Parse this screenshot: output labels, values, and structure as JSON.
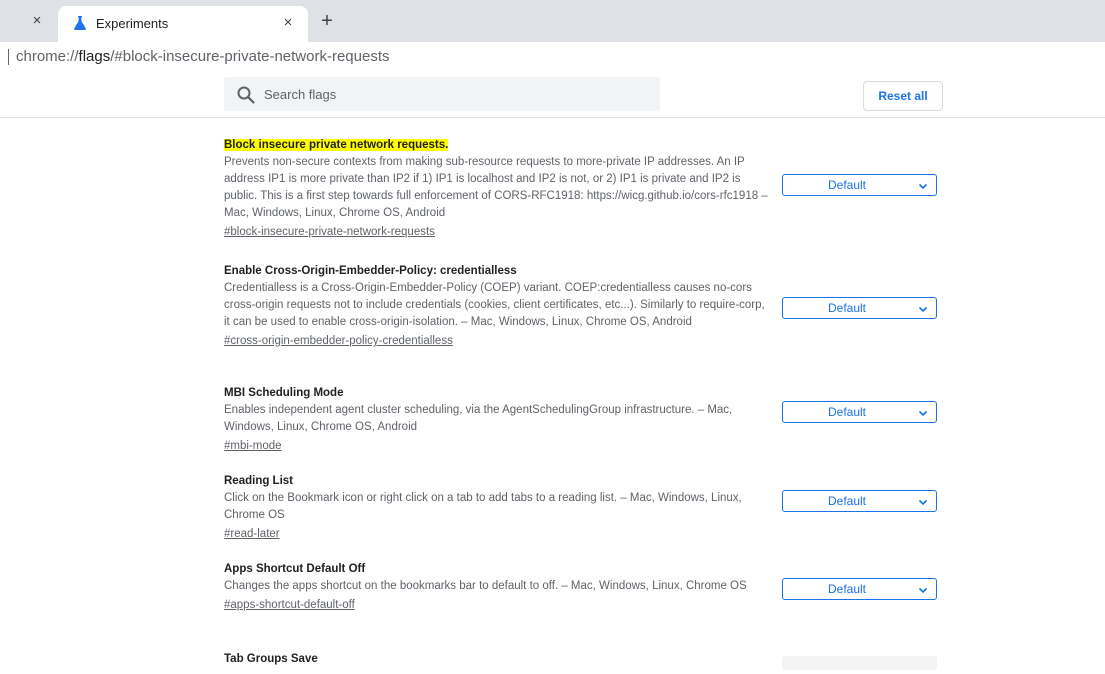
{
  "browser": {
    "tabs": [
      {
        "title": "Experiments",
        "active": true
      }
    ],
    "close_symbol": "×",
    "new_tab_symbol": "+",
    "omnibox": {
      "scheme": "chrome://",
      "host": "flags",
      "fragment": "/#block-insecure-private-network-requests"
    }
  },
  "header": {
    "search_placeholder": "Search flags",
    "reset_label": "Reset all"
  },
  "experiments": [
    {
      "title": "Block insecure private network requests.",
      "highlighted": true,
      "description": "Prevents non-secure contexts from making sub-resource requests to more-private IP addresses. An IP address IP1 is more private than IP2 if 1) IP1 is localhost and IP2 is not, or 2) IP1 is private and IP2 is public. This is a first step towards full enforcement of CORS-RFC1918: https://wicg.github.io/cors-rfc1918 – Mac, Windows, Linux, Chrome OS, Android",
      "link": "#block-insecure-private-network-requests",
      "value": "Default"
    },
    {
      "title": "Enable Cross-Origin-Embedder-Policy: credentialless",
      "highlighted": false,
      "description": "Credentialless is a Cross-Origin-Embedder-Policy (COEP) variant. COEP:credentialless causes no-cors cross-origin requests not to include credentials (cookies, client certificates, etc...). Similarly to require-corp, it can be used to enable cross-origin-isolation. – Mac, Windows, Linux, Chrome OS, Android",
      "link": "#cross-origin-embedder-policy-credentialless",
      "value": "Default"
    },
    {
      "title": "MBI Scheduling Mode",
      "highlighted": false,
      "description": "Enables independent agent cluster scheduling, via the AgentSchedulingGroup infrastructure. – Mac, Windows, Linux, Chrome OS, Android",
      "link": "#mbi-mode",
      "value": "Default"
    },
    {
      "title": "Reading List",
      "highlighted": false,
      "description": "Click on the Bookmark icon or right click on a tab to add tabs to a reading list. – Mac, Windows, Linux, Chrome OS",
      "link": "#read-later",
      "value": "Default"
    },
    {
      "title": "Apps Shortcut Default Off",
      "highlighted": false,
      "description": "Changes the apps shortcut on the bookmarks bar to default to off. – Mac, Windows, Linux, Chrome OS",
      "link": "#apps-shortcut-default-off",
      "value": "Default"
    },
    {
      "title": "Tab Groups Save"
    }
  ],
  "colors": {
    "accent": "#1a73e8",
    "highlight": "#ffff00",
    "tabstrip": "#dee1e6",
    "search_bg": "#f1f3f4",
    "secondary_text": "#5f6368"
  },
  "icons": {
    "favicon": "flask-icon",
    "search": "search-icon",
    "dropdown": "chevron-down-icon"
  }
}
